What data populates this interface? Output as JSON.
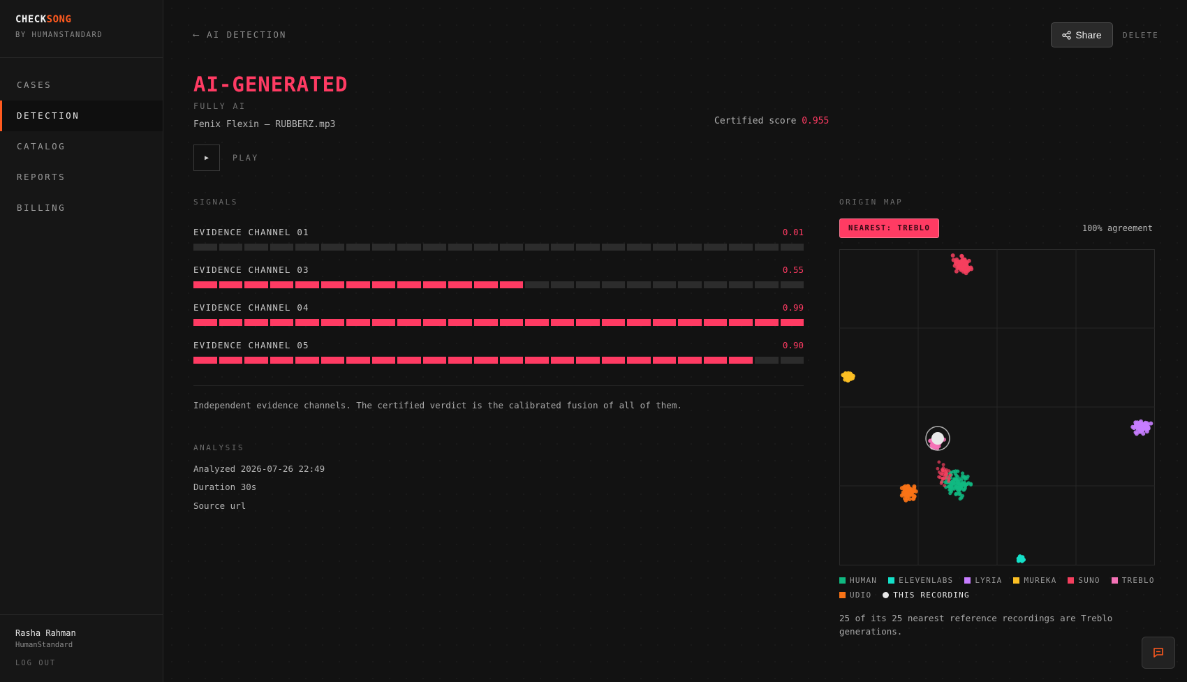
{
  "brand": {
    "name_part1": "CHECK",
    "name_part2": "SONG",
    "tagline": "BY HUMANSTANDARD"
  },
  "nav": {
    "items": [
      {
        "label": "CASES",
        "active": false
      },
      {
        "label": "DETECTION",
        "active": true
      },
      {
        "label": "CATALOG",
        "active": false
      },
      {
        "label": "REPORTS",
        "active": false
      },
      {
        "label": "BILLING",
        "active": false
      }
    ]
  },
  "user": {
    "name": "Rasha Rahman",
    "org": "HumanStandard",
    "logout": "LOG OUT"
  },
  "header": {
    "back_label": "AI DETECTION",
    "share_label": "Share",
    "delete_label": "DELETE"
  },
  "result": {
    "verdict": "AI-GENERATED",
    "verdict_sub": "FULLY AI",
    "file": "Fenix Flexin — RUBBERZ.mp3",
    "certified_label": "Certified score",
    "certified_score": "0.955",
    "play_label": "PLAY"
  },
  "signals": {
    "title": "SIGNALS",
    "segments": 24,
    "channels": [
      {
        "label": "EVIDENCE CHANNEL 01",
        "value": "0.01",
        "level": 0.01
      },
      {
        "label": "EVIDENCE CHANNEL 03",
        "value": "0.55",
        "level": 0.55
      },
      {
        "label": "EVIDENCE CHANNEL 04",
        "value": "0.99",
        "level": 0.99
      },
      {
        "label": "EVIDENCE CHANNEL 05",
        "value": "0.90",
        "level": 0.9
      }
    ],
    "note": "Independent evidence channels. The certified verdict is the calibrated fusion of all of them."
  },
  "analysis": {
    "title": "ANALYSIS",
    "analyzed": "Analyzed 2026-07-26 22:49",
    "duration": "Duration 30s",
    "source": "Source url"
  },
  "origin_map": {
    "title": "ORIGIN MAP",
    "nearest": "NEAREST: TREBLO",
    "agreement": "100% agreement",
    "legend": [
      {
        "label": "HUMAN",
        "color": "#10b981"
      },
      {
        "label": "ELEVENLABS",
        "color": "#14e0c8"
      },
      {
        "label": "LYRIA",
        "color": "#c77dff"
      },
      {
        "label": "MUREKA",
        "color": "#fbbf24"
      },
      {
        "label": "SUNO",
        "color": "#f43f5e"
      },
      {
        "label": "TREBLO",
        "color": "#f472b6"
      },
      {
        "label": "UDIO",
        "color": "#f97316"
      },
      {
        "label": "THIS RECORDING",
        "color": "#e8e8e8"
      }
    ],
    "caption": "25 of its 25 nearest reference recordings are Treblo generations."
  },
  "colors": {
    "accent": "#ff3b63",
    "brand": "#ff5a1f",
    "background": "#121212"
  }
}
